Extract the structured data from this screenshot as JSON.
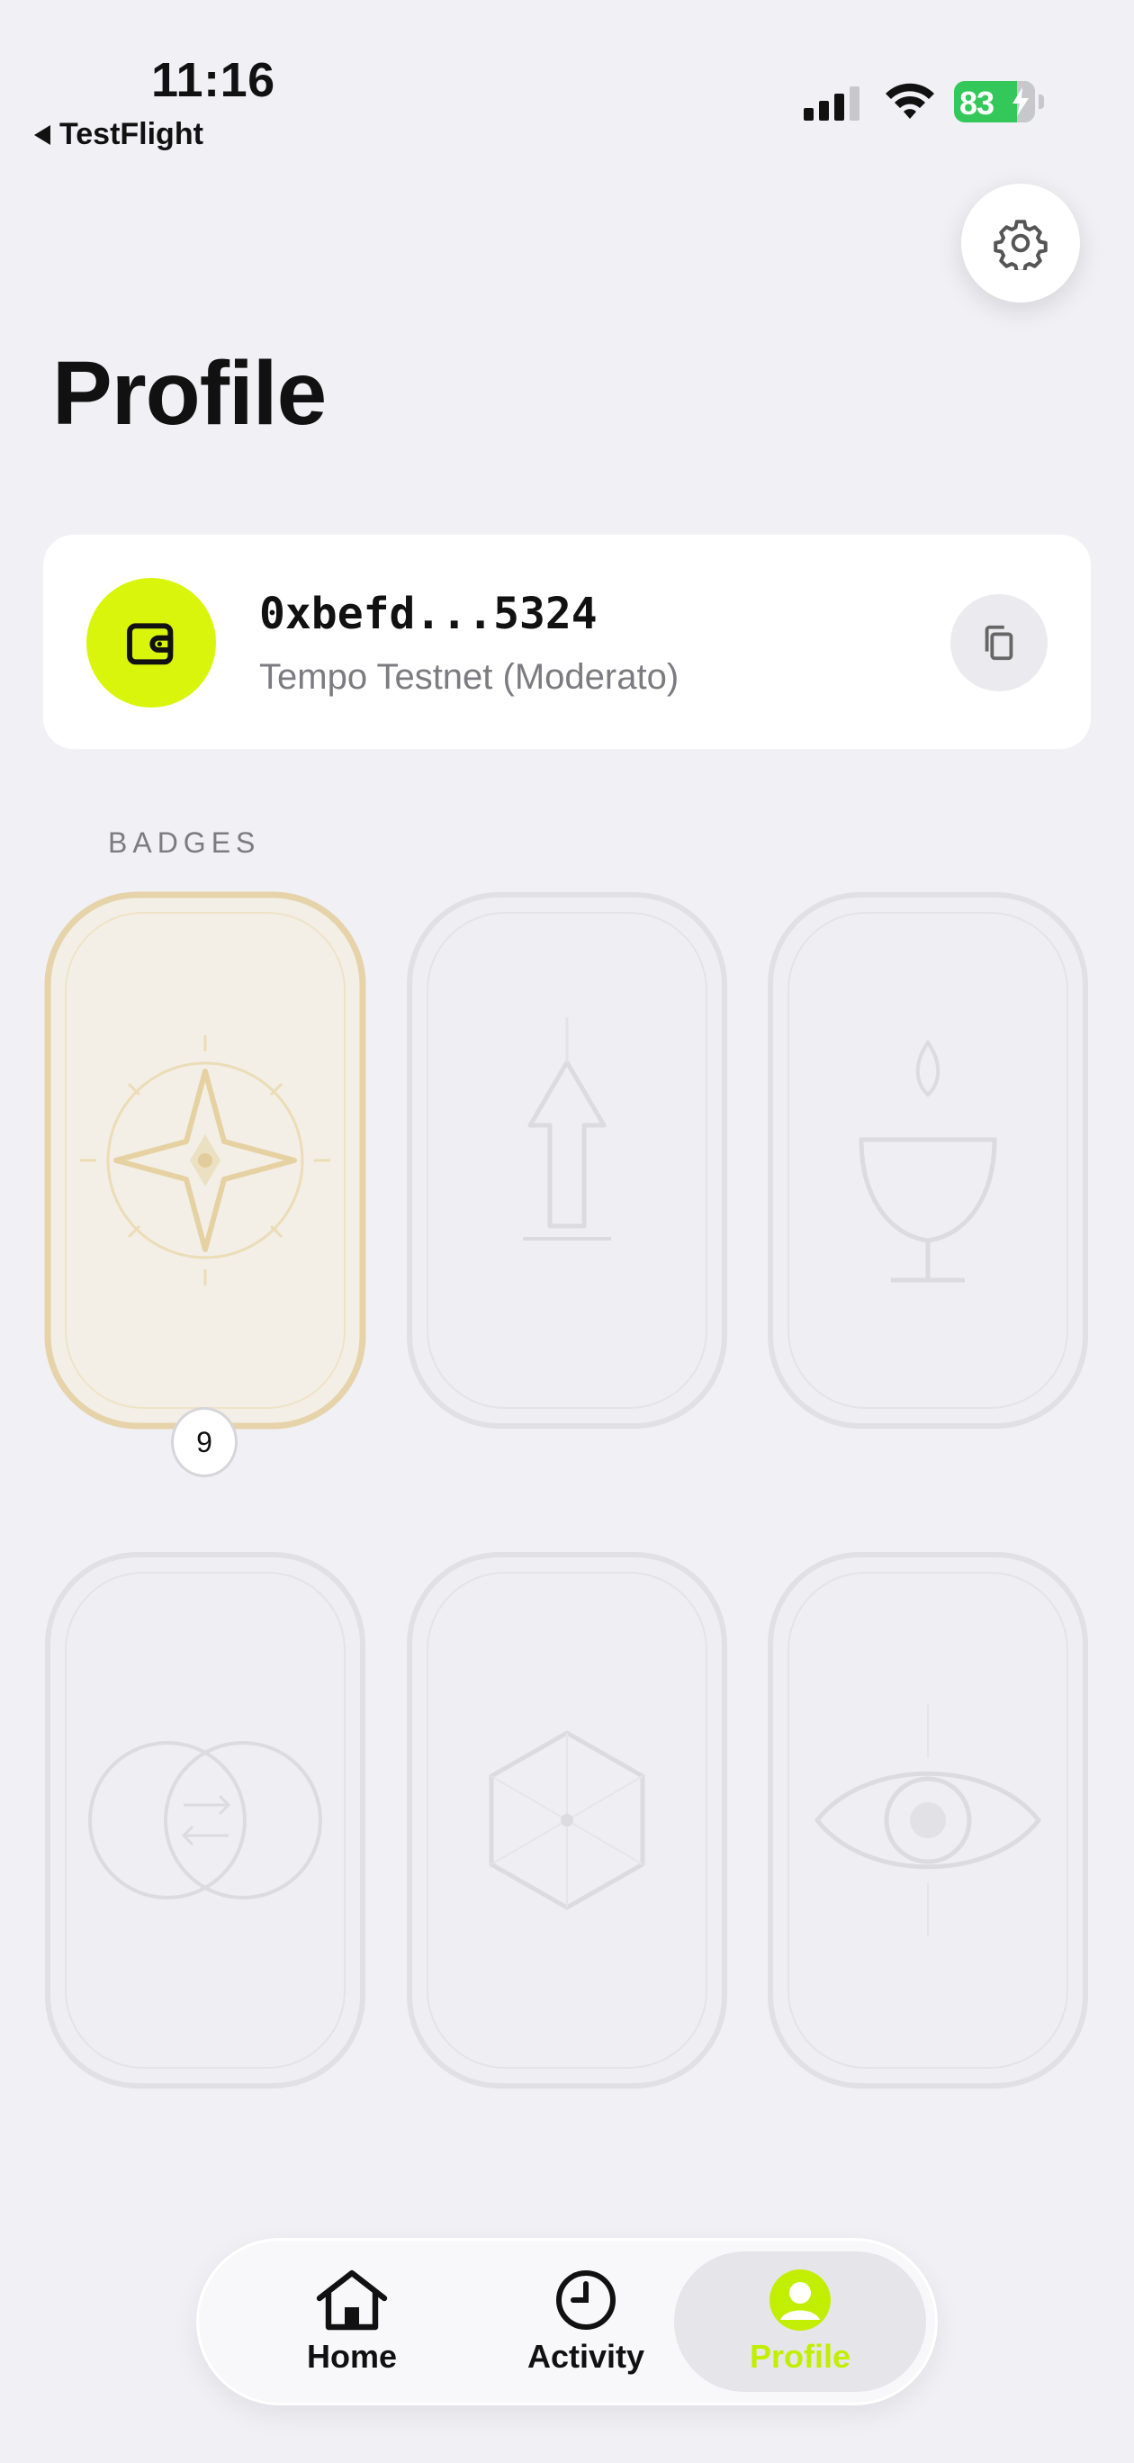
{
  "status_bar": {
    "time": "11:16",
    "back_label": "TestFlight",
    "battery": "83"
  },
  "header": {
    "title": "Profile",
    "settings_icon": "gear-icon"
  },
  "wallet": {
    "address": "0xbefd...5324",
    "network": "Tempo Testnet (Moderato)",
    "icon": "wallet-icon",
    "copy_icon": "copy-icon",
    "accent": "#d8f50b"
  },
  "badges": {
    "section_label": "BADGES",
    "items": [
      {
        "name": "compass-star-badge",
        "earned": true,
        "count": "9"
      },
      {
        "name": "arrow-up-badge",
        "earned": false
      },
      {
        "name": "chalice-flame-badge",
        "earned": false
      },
      {
        "name": "overlap-circles-badge",
        "earned": false
      },
      {
        "name": "hexagon-badge",
        "earned": false
      },
      {
        "name": "eye-badge",
        "earned": false
      }
    ]
  },
  "tabbar": {
    "tabs": [
      {
        "label": "Home",
        "icon": "home-icon"
      },
      {
        "label": "Activity",
        "icon": "clock-icon"
      },
      {
        "label": "Profile",
        "icon": "profile-icon",
        "active": true
      }
    ],
    "active_color": "#c2ef00"
  }
}
